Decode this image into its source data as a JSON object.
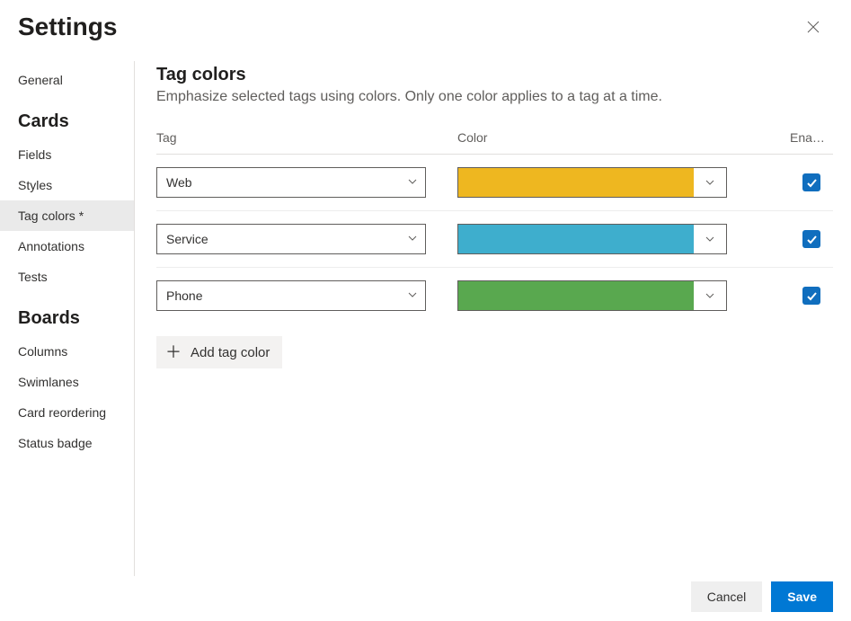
{
  "dialog": {
    "title": "Settings"
  },
  "sidebar": {
    "sections": [
      {
        "title": null,
        "items": [
          {
            "label": "General",
            "active": false
          }
        ]
      },
      {
        "title": "Cards",
        "items": [
          {
            "label": "Fields",
            "active": false
          },
          {
            "label": "Styles",
            "active": false
          },
          {
            "label": "Tag colors *",
            "active": true
          },
          {
            "label": "Annotations",
            "active": false
          },
          {
            "label": "Tests",
            "active": false
          }
        ]
      },
      {
        "title": "Boards",
        "items": [
          {
            "label": "Columns",
            "active": false
          },
          {
            "label": "Swimlanes",
            "active": false
          },
          {
            "label": "Card reordering",
            "active": false
          },
          {
            "label": "Status badge",
            "active": false
          }
        ]
      }
    ]
  },
  "panel": {
    "title": "Tag colors",
    "description": "Emphasize selected tags using colors. Only one color applies to a tag at a time.",
    "columns": {
      "tag": "Tag",
      "color": "Color",
      "enabled": "Ena…"
    },
    "rows": [
      {
        "tag": "Web",
        "color": "#eeb720",
        "enabled": true
      },
      {
        "tag": "Service",
        "color": "#3eaecd",
        "enabled": true
      },
      {
        "tag": "Phone",
        "color": "#59a84f",
        "enabled": true
      }
    ],
    "add_label": "Add tag color"
  },
  "footer": {
    "cancel": "Cancel",
    "save": "Save"
  }
}
